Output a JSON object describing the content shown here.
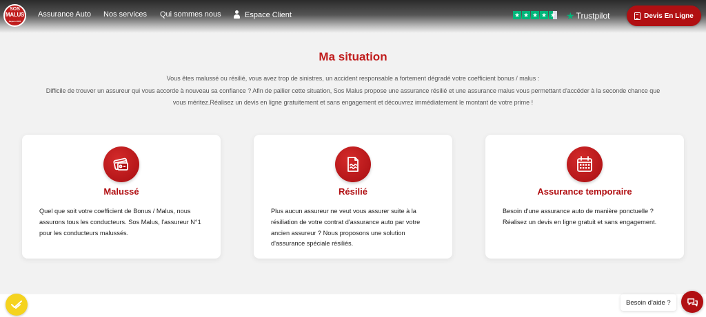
{
  "header": {
    "logo": {
      "line1": "SOS",
      "line2": "MALUS",
      "line3": "Depuis 2005"
    },
    "nav": [
      {
        "label": "Assurance Auto"
      },
      {
        "label": "Nos services"
      },
      {
        "label": "Qui sommes nous"
      },
      {
        "label": "Espace Client",
        "icon": "user-icon"
      }
    ],
    "trustpilot": {
      "label": "Trustpilot",
      "rating": 4.5,
      "max": 5
    },
    "cta_label": "Devis En Ligne",
    "cta_icon": "document-icon"
  },
  "main": {
    "title": "Ma situation",
    "intro": [
      "Vous êtes malussé ou résilié, vous avez trop de sinistres, un accident responsable a fortement dégradé votre coefficient bonus / malus :",
      "Difficile de trouver un assureur qui vous accorde à nouveau sa confiance ? Afin de pallier cette situation, Sos Malus propose une assurance résilié et une assurance malus vous permettant d'accéder à la seconde chance que",
      "vous méritez.Réalisez un devis en ligne gratuitement et sans engagement et découvrez immédiatement le montant de votre prime !"
    ],
    "cards": [
      {
        "icon": "credit-card-icon",
        "title": "Malussé",
        "text": "Quel que soit votre coefficient de Bonus / Malus, nous assurons tous les conducteurs. Sos Malus, l'assureur N°1 pour les conducteurs malussés."
      },
      {
        "icon": "contract-icon",
        "title": "Résilié",
        "text": "Plus aucun assureur ne veut vous assurer suite à la résiliation de votre contrat d'assurance auto par votre ancien assureur ? Nous proposons une solution d'assurance spéciale résiliés."
      },
      {
        "icon": "calendar-icon",
        "title": "Assurance temporaire",
        "text": "Besoin d'une assurance auto de manière ponctuelle ? Réalisez un devis en ligne gratuit et sans engagement."
      }
    ]
  },
  "footer": {
    "help_label": "Besoin d'aide ?",
    "help_icon": "chat-icon",
    "badge_icon": "checkmark-badge-icon"
  },
  "colors": {
    "brand_red": "#b10f12",
    "title_red": "#c01d1d",
    "trustpilot_green": "#00b67a",
    "badge_yellow": "#f5d31f"
  }
}
